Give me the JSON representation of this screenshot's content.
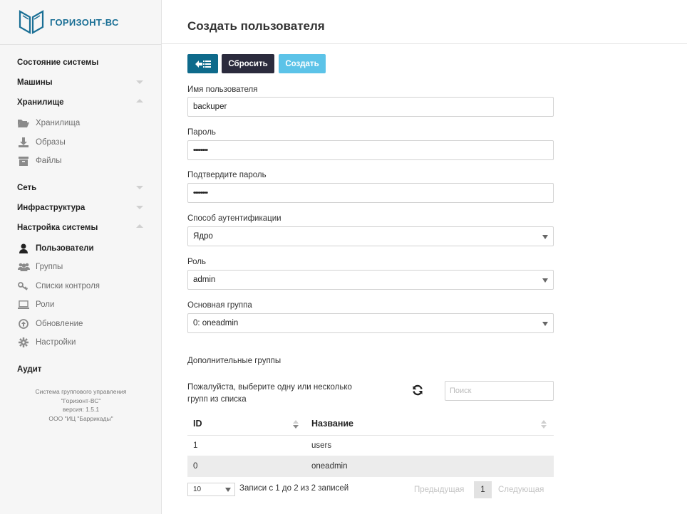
{
  "brand": {
    "name": "ГОРИЗОНТ-ВС"
  },
  "sidebar": {
    "sections": {
      "status": "Состояние системы",
      "machines": "Машины",
      "storage": "Хранилище",
      "storage_items": [
        "Хранилища",
        "Образы",
        "Файлы"
      ],
      "network": "Сеть",
      "infrastructure": "Инфраструктура",
      "system_settings": "Настройка системы",
      "settings_items": [
        "Пользователи",
        "Группы",
        "Списки контроля",
        "Роли",
        "Обновление",
        "Настройки"
      ],
      "audit": "Аудит"
    },
    "footer": [
      "Система группового управления",
      "\"Горизонт-ВС\"",
      "версия: 1.5.1",
      "ООО \"ИЦ \"Баррикады\""
    ]
  },
  "page": {
    "title": "Создать пользователя"
  },
  "toolbar": {
    "reset_label": "Сбросить",
    "create_label": "Создать"
  },
  "form": {
    "username": {
      "label": "Имя пользователя",
      "value": "backuper"
    },
    "password": {
      "label": "Пароль",
      "value": "••••••••"
    },
    "confirm": {
      "label": "Подтвердите пароль",
      "value": "••••••••"
    },
    "auth": {
      "label": "Способ аутентификации",
      "value": "Ядро"
    },
    "role": {
      "label": "Роль",
      "value": "admin"
    },
    "primary_group": {
      "label": "Основная группа",
      "value": "0: oneadmin"
    }
  },
  "groups": {
    "heading": "Дополнительные группы",
    "hint": "Пожалуйста, выберите одну или несколько групп из списка",
    "search_placeholder": "Поиск",
    "columns": [
      "ID",
      "Название"
    ],
    "rows": [
      {
        "id": "1",
        "name": "users"
      },
      {
        "id": "0",
        "name": "oneadmin"
      }
    ],
    "page_size": "10",
    "info": "Записи с 1 до 2 из 2 записей",
    "prev": "Предыдущая",
    "page": "1",
    "next": "Следующая"
  },
  "colors": {
    "accent": "#0e6a8b",
    "dark_button": "#2b2b3d",
    "create_button": "#5cc3e8",
    "brand": "#1a6f95"
  }
}
